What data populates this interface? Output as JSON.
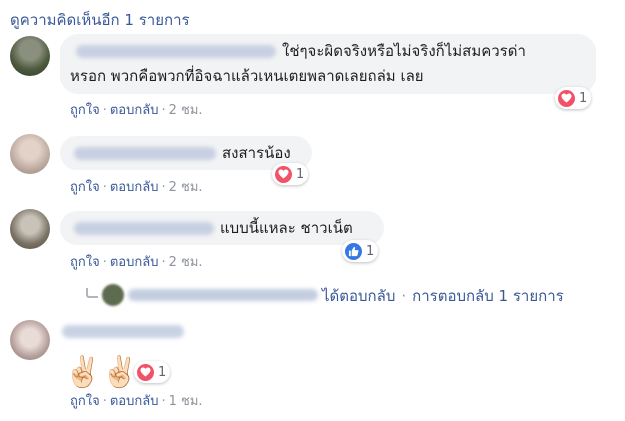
{
  "view_more": "ดูความคิดเห็นอีก 1 รายการ",
  "actions": {
    "like": "ถูกใจ",
    "reply": "ตอบกลับ",
    "sep": "·"
  },
  "comments": [
    {
      "lines": [
        "ใช่ๆจะผิดจริงหรือไม่จริงก็ไม่สมควรด่า",
        "หรอก พวกคือพวกที่อิจฉาแล้วเหนเตยพลาดเลยถล่ม เลย"
      ],
      "reaction": "heart",
      "reaction_count": "1",
      "time": "2 ชม."
    },
    {
      "text": "สงสารน้อง",
      "reaction": "heart",
      "reaction_count": "1",
      "time": "2 ชม."
    },
    {
      "text": "แบบนี้แหละ ชาวเน็ต",
      "reaction": "like",
      "reaction_count": "1",
      "time": "2 ชม."
    },
    {
      "text": "✌🏻✌🏻",
      "reaction": "heart",
      "reaction_count": "1",
      "time": "1 ชม."
    }
  ],
  "reply_summary": {
    "replied": "ได้ตอบกลับ",
    "sep": "·",
    "count": "การตอบกลับ 1 รายการ"
  },
  "colors": {
    "link": "#385898",
    "bubble": "#f2f3f5",
    "heart": "#f25268",
    "like": "#3578e5",
    "meta": "#8d949e"
  }
}
